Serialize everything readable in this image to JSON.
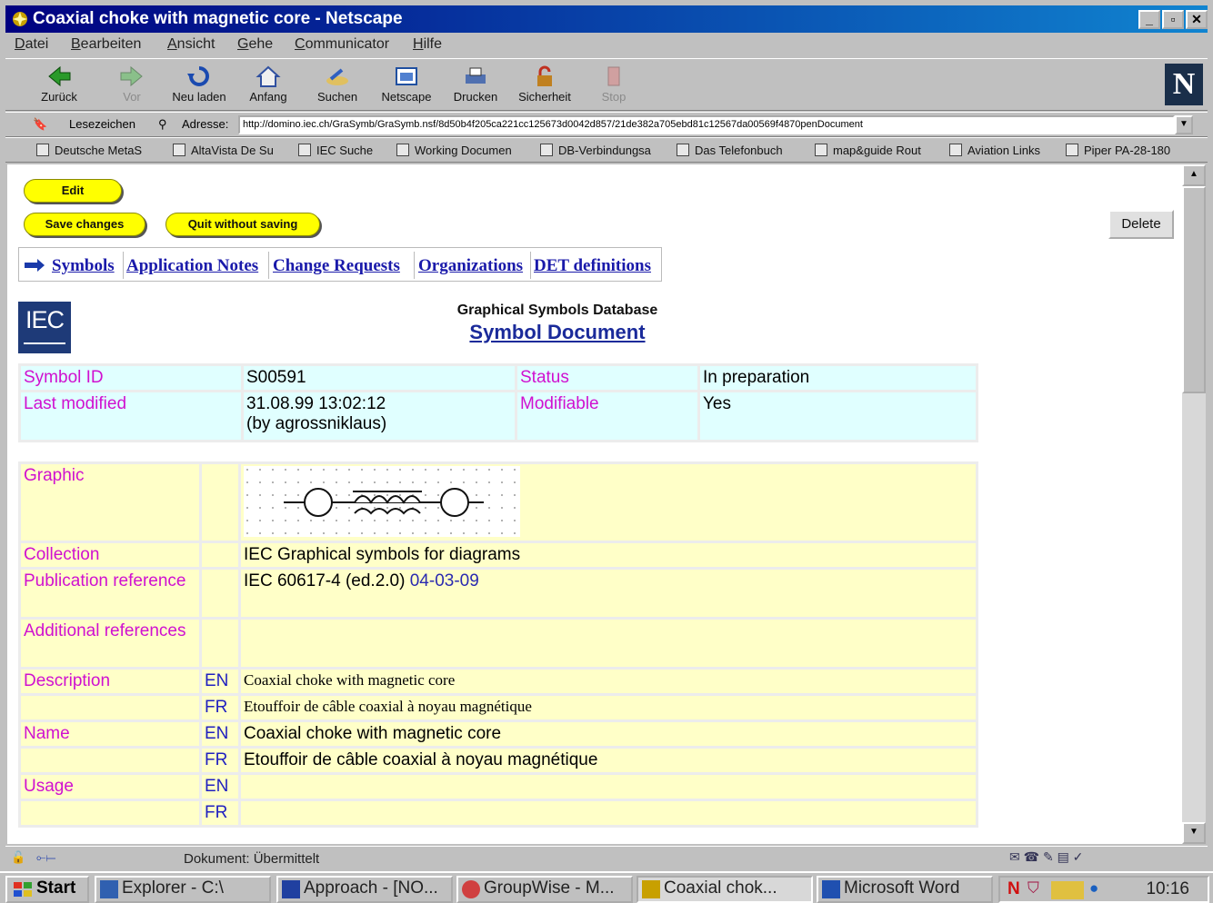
{
  "window": {
    "title": "Coaxial choke with magnetic core - Netscape"
  },
  "menu": [
    "Datei",
    "Bearbeiten",
    "Ansicht",
    "Gehe",
    "Communicator",
    "Hilfe"
  ],
  "toolbar": {
    "back": "Zurück",
    "forward": "Vor",
    "reload": "Neu laden",
    "home": "Anfang",
    "search": "Suchen",
    "netscape": "Netscape",
    "print": "Drucken",
    "security": "Sicherheit",
    "stop": "Stop"
  },
  "location": {
    "bookmarks_label": "Lesezeichen",
    "address_label": "Adresse:",
    "url": "http://domino.iec.ch/GraSymb/GraSymb.nsf/8d50b4f205ca221cc125673d0042d857/21de382a705ebd81c12567da00569f4870penDocument"
  },
  "bookmarks": [
    "Deutsche MetaS",
    "AltaVista De Su",
    "IEC Suche",
    "Working Documen",
    "DB-Verbindungsa",
    "Das Telefonbuch",
    "map&guide Rout",
    "Aviation Links",
    "Piper PA-28-180"
  ],
  "actions": {
    "edit": "Edit",
    "save": "Save changes",
    "quit": "Quit without saving",
    "delete": "Delete"
  },
  "tabs": [
    "Symbols",
    "Application Notes",
    "Change Requests",
    "Organizations",
    "DET definitions"
  ],
  "header": {
    "logo": "IEC",
    "db_title": "Graphical Symbols Database",
    "doc_title": "Symbol Document"
  },
  "meta": {
    "symbol_id_label": "Symbol ID",
    "symbol_id": "S00591",
    "status_label": "Status",
    "status": "In preparation",
    "last_modified_label": "Last modified",
    "last_modified": "31.08.99 13:02:12",
    "modified_by": "(by agrossniklaus)",
    "modifiable_label": "Modifiable",
    "modifiable": "Yes"
  },
  "detail": {
    "graphic_label": "Graphic",
    "collection_label": "Collection",
    "collection": "IEC Graphical symbols for diagrams",
    "publication_label": "Publication reference",
    "publication": "IEC 60617-4 (ed.2.0)",
    "publication_link": "04-03-09",
    "additional_label": "Additional references",
    "description_label": "Description",
    "description_en": "Coaxial choke with magnetic core",
    "description_fr": "Etouffoir de câble coaxial à noyau magnétique",
    "name_label": "Name",
    "name_en": "Coaxial choke with magnetic core",
    "name_fr": "Etouffoir de câble coaxial à noyau magnétique",
    "usage_label": "Usage",
    "lang_en": "EN",
    "lang_fr": "FR"
  },
  "status_bar": {
    "text": "Dokument: Übermittelt"
  },
  "taskbar": {
    "start": "Start",
    "items": [
      "Explorer - C:\\",
      "Approach - [NO...",
      "GroupWise - M...",
      "Coaxial chok...",
      "Microsoft Word"
    ],
    "clock": "10:16"
  },
  "colors": {
    "title_bar": "#000080",
    "meta_bg": "#e0ffff",
    "detail_bg": "#ffffc8",
    "label": "#d010d0",
    "link": "#1a1aaa",
    "button_yellow": "#ffff00"
  }
}
